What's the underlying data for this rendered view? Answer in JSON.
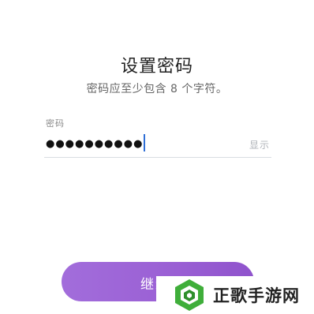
{
  "header": {
    "title": "设置密码",
    "subtitle": "密码应至少包含 8 个字符。"
  },
  "password_field": {
    "label": "密码",
    "masked_value": "●●●●●●●●●●",
    "show_toggle_label": "显示"
  },
  "continue_button": {
    "label": "继续"
  },
  "watermark": {
    "text": "正歌手游网"
  },
  "colors": {
    "accent": "#9a5fd4",
    "caret": "#2f6fd6",
    "logo_green": "#3fae3a"
  }
}
